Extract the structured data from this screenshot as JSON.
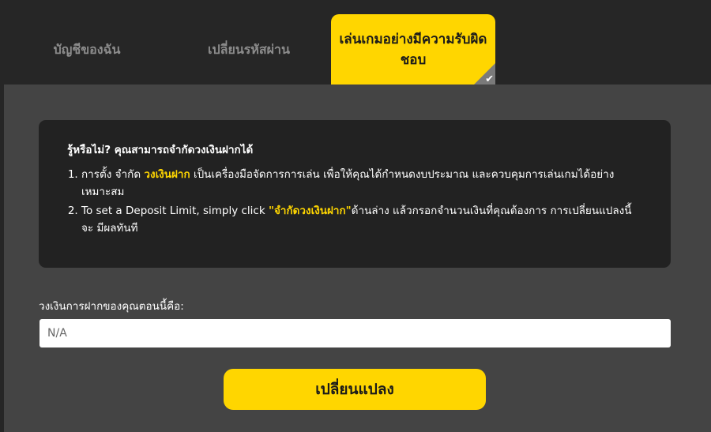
{
  "tabs": [
    {
      "label": "บัญชีของฉัน",
      "active": false
    },
    {
      "label": "เปลี่ยนรหัสผ่าน",
      "active": false
    },
    {
      "label": "เล่นเกมอย่างมีความรับผิดชอบ",
      "active": true
    }
  ],
  "info": {
    "title": "รู้หรือไม่? คุณสามารถจำกัดวงเงินฝากได้",
    "item1": {
      "prefix": "การตั้ง จำกัด ",
      "highlight": "วงเงินฝาก",
      "suffix": " เป็นเครื่องมือจัดการการเล่น เพื่อให้คุณได้กำหนดงบประมาณ และควบคุมการเล่นเกมได้อย่างเหมาะสม"
    },
    "item2": {
      "prefix": "To set a Deposit Limit, simply click ",
      "highlight": "\"จำกัดวงเงินฝาก\"",
      "suffix": "ด้านล่าง แล้วกรอกจำนวนเงินที่คุณต้องการ การเปลี่ยนแปลงนี้จะ มีผลทันที"
    }
  },
  "deposit": {
    "label": "วงเงินการฝากของคุณตอนนี้คือ:",
    "value": "N/A"
  },
  "button": {
    "label": "เปลี่ยนแปลง"
  },
  "colors": {
    "accent": "#ffd600",
    "page_bg": "#262626",
    "panel_bg": "#444444",
    "box_bg": "#222222"
  },
  "icons": {
    "active_tab_marker": "check-icon"
  }
}
